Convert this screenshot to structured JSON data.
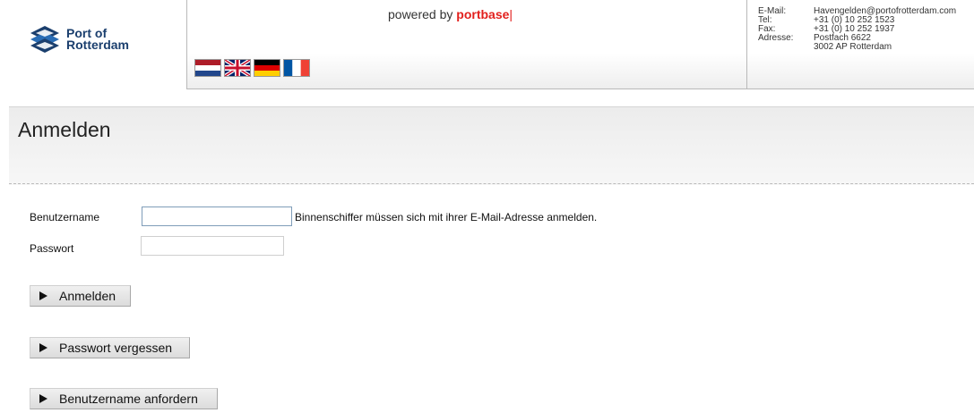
{
  "header": {
    "logo_text_line1": "Port of",
    "logo_text_line2": "Rotterdam",
    "powered_prefix": "powered by ",
    "powered_brand": "portbase",
    "flags": [
      {
        "icon": "flag-nl-icon",
        "lang": "nl"
      },
      {
        "icon": "flag-uk-icon",
        "lang": "en"
      },
      {
        "icon": "flag-de-icon",
        "lang": "de"
      },
      {
        "icon": "flag-fr-icon",
        "lang": "fr"
      }
    ],
    "contact": {
      "email_label": "E-Mail:",
      "email_value": "Havengelden@portofrotterdam.com",
      "tel_label": "Tel:",
      "tel_value": "+31 (0) 10 252 1523",
      "fax_label": "Fax:",
      "fax_value": "+31 (0) 10 252 1937",
      "address_label": "Adresse:",
      "address_line1": "Postfach 6622",
      "address_line2": "3002 AP  Rotterdam"
    }
  },
  "main": {
    "title": "Anmelden",
    "username_label": "Benutzername",
    "username_value": "",
    "username_hint": "Binnenschiffer müssen sich mit ihrer E-Mail-Adresse anmelden.",
    "password_label": "Passwort",
    "password_value": "",
    "buttons": {
      "login": "Anmelden",
      "forgot_password": "Passwort vergessen",
      "request_username": "Benutzername anfordern"
    }
  },
  "colors": {
    "brand_navy": "#1b3f6e",
    "portbase_red": "#e2201d"
  }
}
